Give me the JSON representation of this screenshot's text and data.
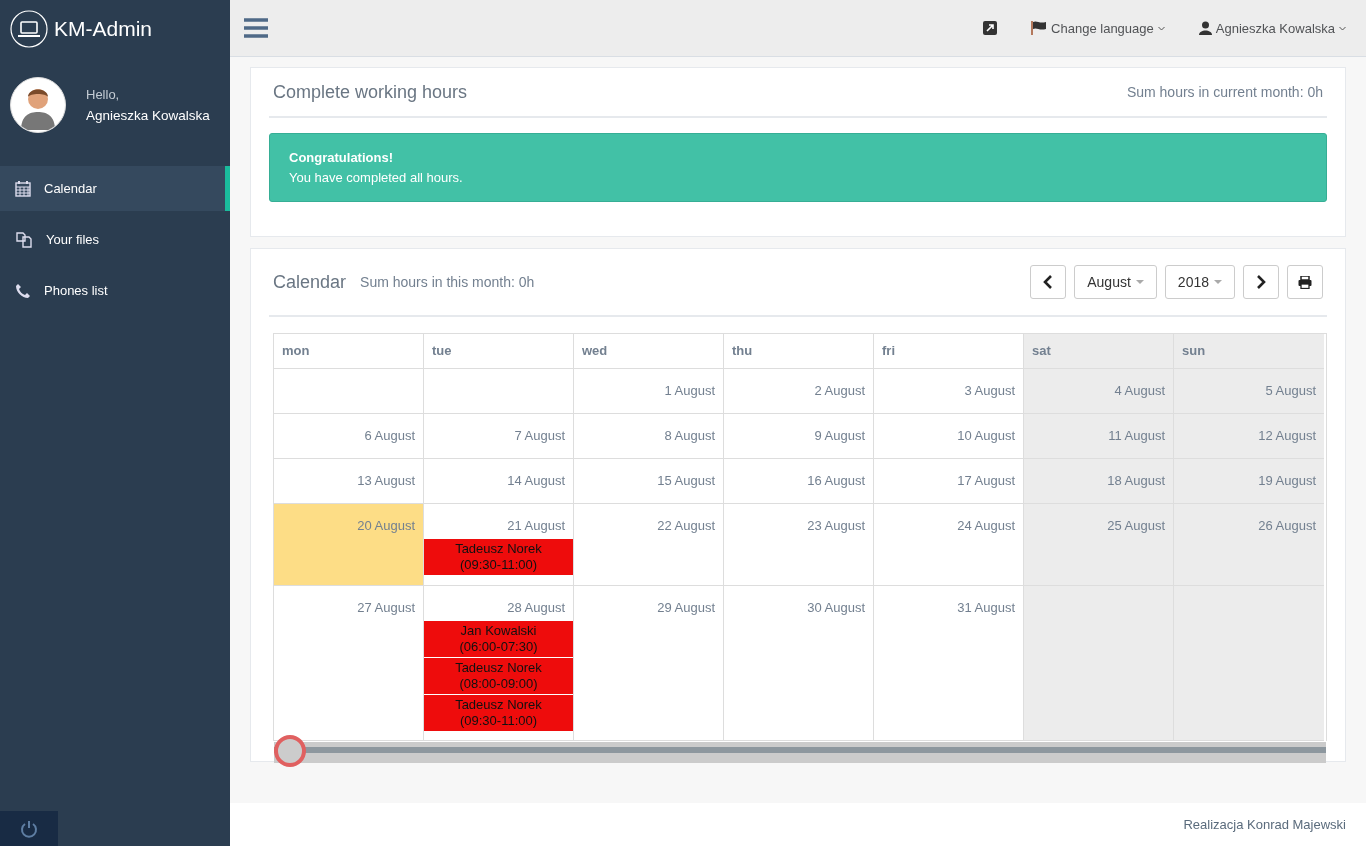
{
  "brand": {
    "title": "KM-Admin"
  },
  "profile": {
    "greeting": "Hello,",
    "name": "Agnieszka Kowalska"
  },
  "sidebar": {
    "items": [
      {
        "label": "Calendar",
        "selected": true
      },
      {
        "label": "Your files",
        "selected": false
      },
      {
        "label": "Phones list",
        "selected": false
      }
    ]
  },
  "topbar": {
    "language": "Change language",
    "user": "Agnieszka Kowalska"
  },
  "hours_panel": {
    "title": "Complete working hours",
    "sum": "Sum hours in current month: 0h",
    "alert": {
      "title": "Congratulations!",
      "text": "You have completed all hours."
    }
  },
  "calendar": {
    "title": "Calendar",
    "sum": "Sum hours in this month: 0h",
    "month": "August",
    "year": "2018",
    "columns": [
      {
        "label": "mon",
        "weekend": false
      },
      {
        "label": "tue",
        "weekend": false
      },
      {
        "label": "wed",
        "weekend": false
      },
      {
        "label": "thu",
        "weekend": false
      },
      {
        "label": "fri",
        "weekend": false
      },
      {
        "label": "sat",
        "weekend": true
      },
      {
        "label": "sun",
        "weekend": true
      }
    ],
    "weeks": [
      {
        "days": [
          {
            "today": false
          },
          {
            "today": false
          },
          {
            "date": "1 August",
            "today": false
          },
          {
            "date": "2 August",
            "today": false
          },
          {
            "date": "3 August",
            "today": false
          },
          {
            "date": "4 August",
            "today": false
          },
          {
            "date": "5 August",
            "today": false
          }
        ]
      },
      {
        "days": [
          {
            "date": "6 August",
            "today": false
          },
          {
            "date": "7 August",
            "today": false
          },
          {
            "date": "8 August",
            "today": false
          },
          {
            "date": "9 August",
            "today": false
          },
          {
            "date": "10 August",
            "today": false
          },
          {
            "date": "11 August",
            "today": false
          },
          {
            "date": "12 August",
            "today": false
          }
        ]
      },
      {
        "days": [
          {
            "date": "13 August",
            "today": false
          },
          {
            "date": "14 August",
            "today": false
          },
          {
            "date": "15 August",
            "today": false
          },
          {
            "date": "16 August",
            "today": false
          },
          {
            "date": "17 August",
            "today": false
          },
          {
            "date": "18 August",
            "today": false
          },
          {
            "date": "19 August",
            "today": false
          }
        ]
      },
      {
        "days": [
          {
            "date": "20 August",
            "today": true
          },
          {
            "date": "21 August",
            "today": false,
            "events": [
              {
                "name": "Tadeusz Norek",
                "time": "(09:30-11:00)",
                "color": "#ee0c0c"
              }
            ]
          },
          {
            "date": "22 August",
            "today": false
          },
          {
            "date": "23 August",
            "today": false
          },
          {
            "date": "24 August",
            "today": false
          },
          {
            "date": "25 August",
            "today": false
          },
          {
            "date": "26 August",
            "today": false
          }
        ]
      },
      {
        "days": [
          {
            "date": "27 August",
            "today": false
          },
          {
            "date": "28 August",
            "today": false,
            "events": [
              {
                "name": "Jan Kowalski",
                "time": "(06:00-07:30)",
                "color": "#ee0c0c"
              },
              {
                "name": "Tadeusz Norek",
                "time": "(08:00-09:00)",
                "color": "#ee0c0c"
              },
              {
                "name": "Tadeusz Norek",
                "time": "(09:30-11:00)",
                "color": "#ee0c0c"
              }
            ]
          },
          {
            "date": "29 August",
            "today": false
          },
          {
            "date": "30 August",
            "today": false
          },
          {
            "date": "31 August",
            "today": false
          },
          {
            "today": false
          },
          {
            "today": false
          }
        ]
      }
    ],
    "slider": {
      "level": 0
    }
  },
  "footer": {
    "text": "Realizacja Konrad Majewski"
  }
}
